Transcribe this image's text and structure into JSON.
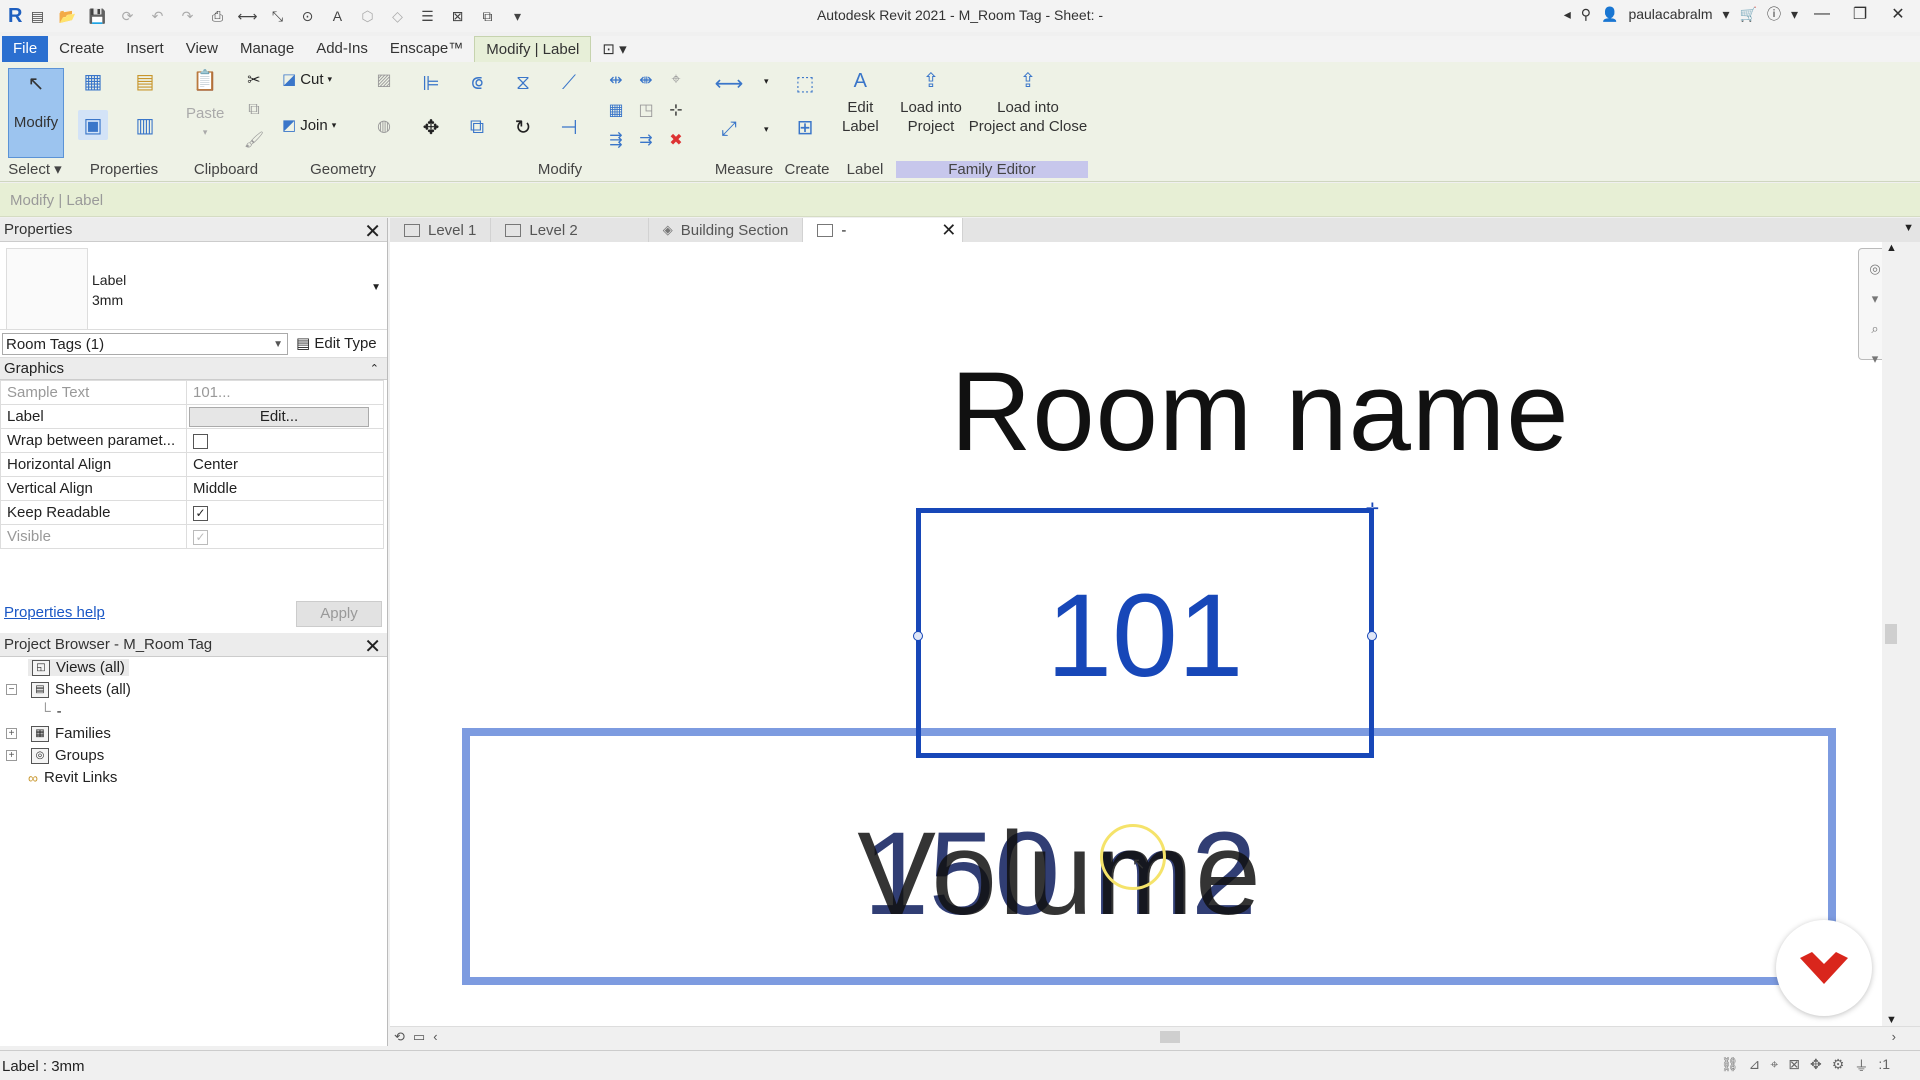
{
  "window": {
    "title": "Autodesk Revit 2021 - M_Room Tag - Sheet: -",
    "user": "paulacabralm"
  },
  "ribbon_tabs": [
    "File",
    "Create",
    "Insert",
    "View",
    "Manage",
    "Add-Ins",
    "Enscape™",
    "Modify | Label"
  ],
  "ribbon": {
    "modify_label": "Modify",
    "panels": {
      "select": "Select ▾",
      "properties": "Properties",
      "clipboard": "Clipboard",
      "geometry": "Geometry",
      "modify": "Modify",
      "measure": "Measure",
      "create": "Create",
      "label": "Label",
      "family_editor": "Family Editor"
    },
    "paste": "Paste",
    "cut": "Cut",
    "join": "Join",
    "edit_label": "Edit Label",
    "edit_label_1": "Edit",
    "edit_label_2": "Label",
    "load_project_1": "Load into",
    "load_project_2": "Project",
    "load_close_1": "Load into",
    "load_close_2": "Project and Close"
  },
  "options_bar": {
    "context": "Modify | Label"
  },
  "properties": {
    "title": "Properties",
    "type_name_1": "Label",
    "type_name_2": "3mm",
    "instance_filter": "Room Tags (1)",
    "edit_type": "Edit Type",
    "group": "Graphics",
    "rows": [
      {
        "name": "Sample Text",
        "value": "101..."
      },
      {
        "name": "Label",
        "value": "Edit..."
      },
      {
        "name": "Wrap between paramet...",
        "value": ""
      },
      {
        "name": "Horizontal Align",
        "value": "Center"
      },
      {
        "name": "Vertical Align",
        "value": "Middle"
      },
      {
        "name": "Keep Readable",
        "value": "✓"
      },
      {
        "name": "Visible",
        "value": "✓"
      }
    ],
    "help": "Properties help",
    "apply": "Apply"
  },
  "browser": {
    "title": "Project Browser - M_Room Tag",
    "items": [
      {
        "label": "Views (all)"
      },
      {
        "label": "Sheets (all)"
      },
      {
        "label": "-"
      },
      {
        "label": "Families"
      },
      {
        "label": "Groups"
      },
      {
        "label": "Revit Links"
      }
    ]
  },
  "view_tabs": [
    "Level 1",
    "Level 2",
    "Building Section",
    "-"
  ],
  "canvas": {
    "room_name": "Room name",
    "room_number": "101",
    "area_value": "150 m2",
    "area_label_overlap": "Volume"
  },
  "status": {
    "text": "Label : 3mm",
    "filter_count": ":1"
  },
  "colors": {
    "selected_label": "#1747b8",
    "area_box": "#7d9be0",
    "file_tab": "#2b6fd0",
    "contextual_tab": "#e7efd8",
    "family_editor": "#c7c7ec"
  }
}
